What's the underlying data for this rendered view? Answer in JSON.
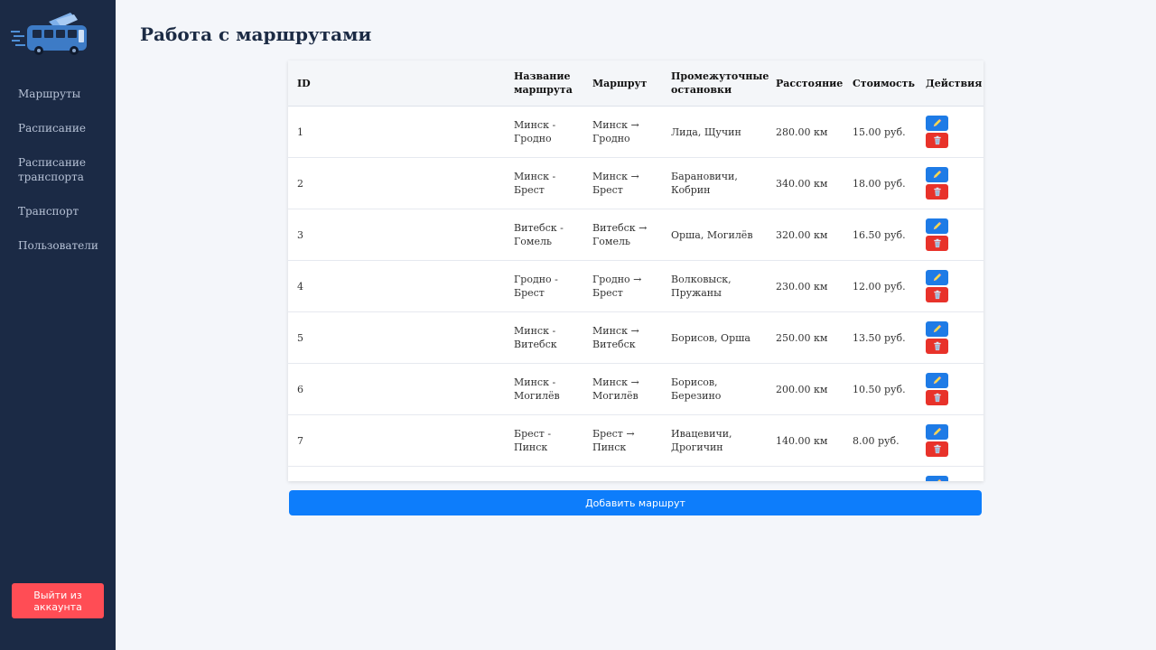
{
  "sidebar": {
    "nav": [
      "Маршруты",
      "Расписание",
      "Расписание транспорта",
      "Транспорт",
      "Пользователи"
    ],
    "logout": "Выйти из аккаунта"
  },
  "page": {
    "title": "Работа с маршрутами"
  },
  "table": {
    "headers": {
      "id": "ID",
      "name": "Название маршрута",
      "route": "Маршрут",
      "stops": "Промежуточные остановки",
      "distance": "Расстояние",
      "cost": "Стоимость",
      "actions": "Действия"
    },
    "rows": [
      {
        "id": "1",
        "name": "Минск - Гродно",
        "route": "Минск → Гродно",
        "stops": "Лида, Щучин",
        "distance": "280.00 км",
        "cost": "15.00 руб."
      },
      {
        "id": "2",
        "name": "Минск - Брест",
        "route": "Минск → Брест",
        "stops": "Барановичи, Кобрин",
        "distance": "340.00 км",
        "cost": "18.00 руб."
      },
      {
        "id": "3",
        "name": "Витебск - Гомель",
        "route": "Витебск → Гомель",
        "stops": "Орша, Могилёв",
        "distance": "320.00 км",
        "cost": "16.50 руб."
      },
      {
        "id": "4",
        "name": "Гродно - Брест",
        "route": "Гродно → Брест",
        "stops": "Волковыск, Пружаны",
        "distance": "230.00 км",
        "cost": "12.00 руб."
      },
      {
        "id": "5",
        "name": "Минск - Витебск",
        "route": "Минск → Витебск",
        "stops": "Борисов, Орша",
        "distance": "250.00 км",
        "cost": "13.50 руб."
      },
      {
        "id": "6",
        "name": "Минск - Могилёв",
        "route": "Минск → Могилёв",
        "stops": "Борисов, Березино",
        "distance": "200.00 км",
        "cost": "10.50 руб."
      },
      {
        "id": "7",
        "name": "Брест - Пинск",
        "route": "Брест → Пинск",
        "stops": "Ивацевичи, Дрогичин",
        "distance": "140.00 км",
        "cost": "8.00 руб."
      },
      {
        "id": "",
        "name": "",
        "route": "",
        "stops": "",
        "distance": "",
        "cost": ""
      }
    ]
  },
  "add_button": "Добавить маршрут",
  "icons": {
    "logo": "bus-logo-icon",
    "edit": "pencil-icon",
    "delete": "trash-icon"
  },
  "colors": {
    "sidebar": "#1b2a45",
    "primary": "#0d7dfb",
    "danger": "#e8322a",
    "logout": "#ff4d55"
  }
}
